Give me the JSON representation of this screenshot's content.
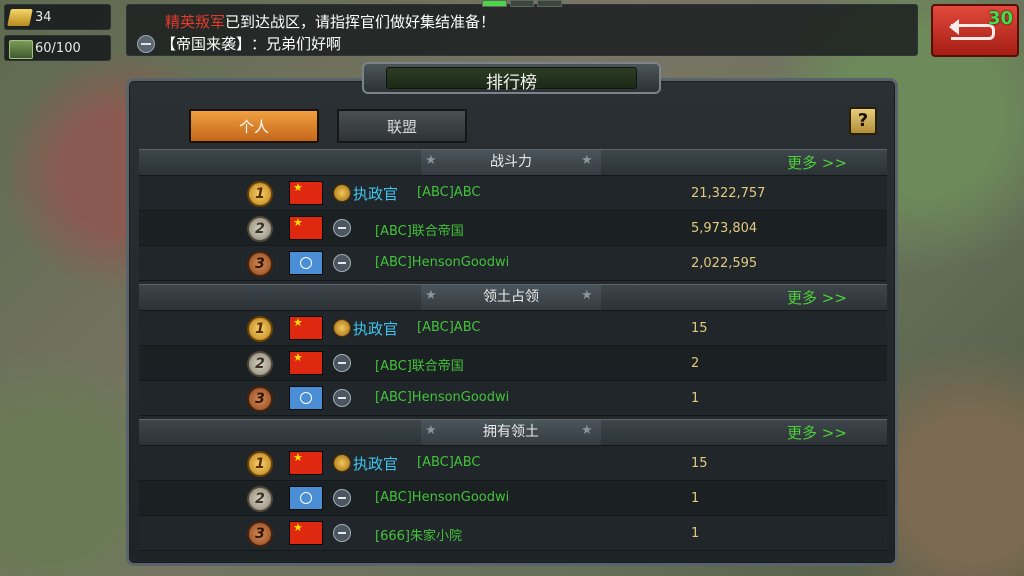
{
  "resources": {
    "gold": "34",
    "supply": "60/100"
  },
  "chat": {
    "line1_highlight": "精英叛军",
    "line1_rest": "已到达战区，请指挥官们做好集结准备！",
    "line2_channel": "【帝国来袭】",
    "line2_message": "：兄弟们好啊"
  },
  "exit_button": {
    "counter": "30"
  },
  "panel": {
    "title": "排行榜",
    "tabs": [
      "个人",
      "联盟"
    ],
    "help_label": "?",
    "more_label": "更多 >>",
    "sections": [
      {
        "label": "战斗力",
        "rows": [
          {
            "rank": "1",
            "flag": "cn",
            "badge": "gold",
            "title": "执政官",
            "name": "[ABC]ABC",
            "value": "21,322,757"
          },
          {
            "rank": "2",
            "flag": "cn",
            "badge": "minus",
            "title": "",
            "name": "[ABC]联合帝国",
            "value": "5,973,804"
          },
          {
            "rank": "3",
            "flag": "un",
            "badge": "minus",
            "title": "",
            "name": "[ABC]HensonGoodwi",
            "value": "2,022,595"
          }
        ]
      },
      {
        "label": "领土占领",
        "rows": [
          {
            "rank": "1",
            "flag": "cn",
            "badge": "gold",
            "title": "执政官",
            "name": "[ABC]ABC",
            "value": "15"
          },
          {
            "rank": "2",
            "flag": "cn",
            "badge": "minus",
            "title": "",
            "name": "[ABC]联合帝国",
            "value": "2"
          },
          {
            "rank": "3",
            "flag": "un",
            "badge": "minus",
            "title": "",
            "name": "[ABC]HensonGoodwi",
            "value": "1"
          }
        ]
      },
      {
        "label": "拥有领土",
        "rows": [
          {
            "rank": "1",
            "flag": "cn",
            "badge": "gold",
            "title": "执政官",
            "name": "[ABC]ABC",
            "value": "15"
          },
          {
            "rank": "2",
            "flag": "un",
            "badge": "minus",
            "title": "",
            "name": "[ABC]HensonGoodwi",
            "value": "1"
          },
          {
            "rank": "3",
            "flag": "cn",
            "badge": "minus",
            "title": "",
            "name": "[666]朱家小院",
            "value": "1"
          }
        ]
      }
    ]
  }
}
